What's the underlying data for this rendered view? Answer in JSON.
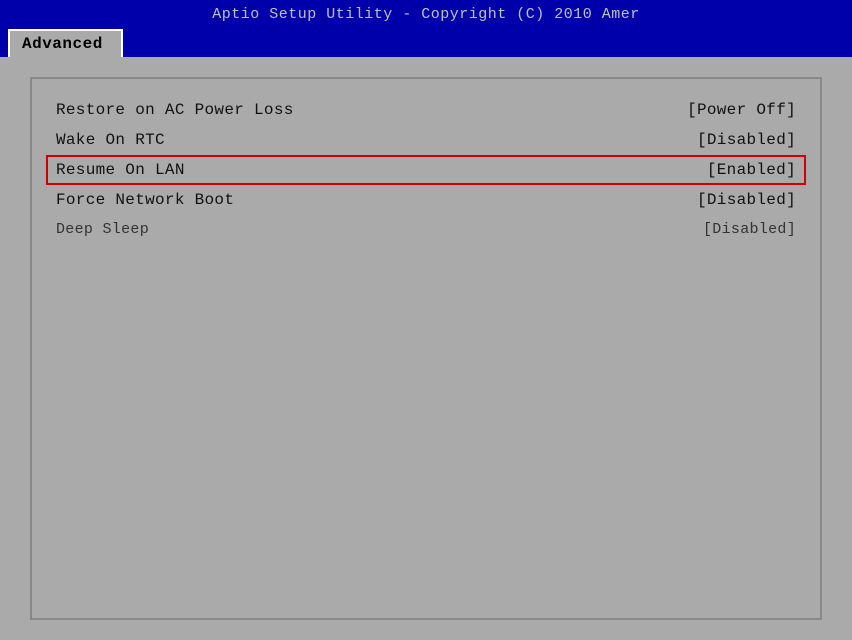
{
  "title_bar": {
    "text": "Aptio Setup Utility - Copyright (C) 2010 Amer"
  },
  "tab": {
    "label": "Advanced"
  },
  "settings": [
    {
      "id": "restore-ac-power",
      "label": "Restore on AC Power Loss",
      "value": "[Power Off]",
      "highlighted": false,
      "dim": false
    },
    {
      "id": "wake-on-rtc",
      "label": "Wake On RTC",
      "value": "[Disabled]",
      "highlighted": false,
      "dim": false
    },
    {
      "id": "resume-on-lan",
      "label": "Resume On LAN",
      "value": "[Enabled]",
      "highlighted": true,
      "dim": false
    },
    {
      "id": "force-network-boot",
      "label": "Force Network Boot",
      "value": "[Disabled]",
      "highlighted": false,
      "dim": false
    },
    {
      "id": "deep-sleep",
      "label": "Deep Sleep",
      "value": "[Disabled]",
      "highlighted": false,
      "dim": true
    }
  ]
}
